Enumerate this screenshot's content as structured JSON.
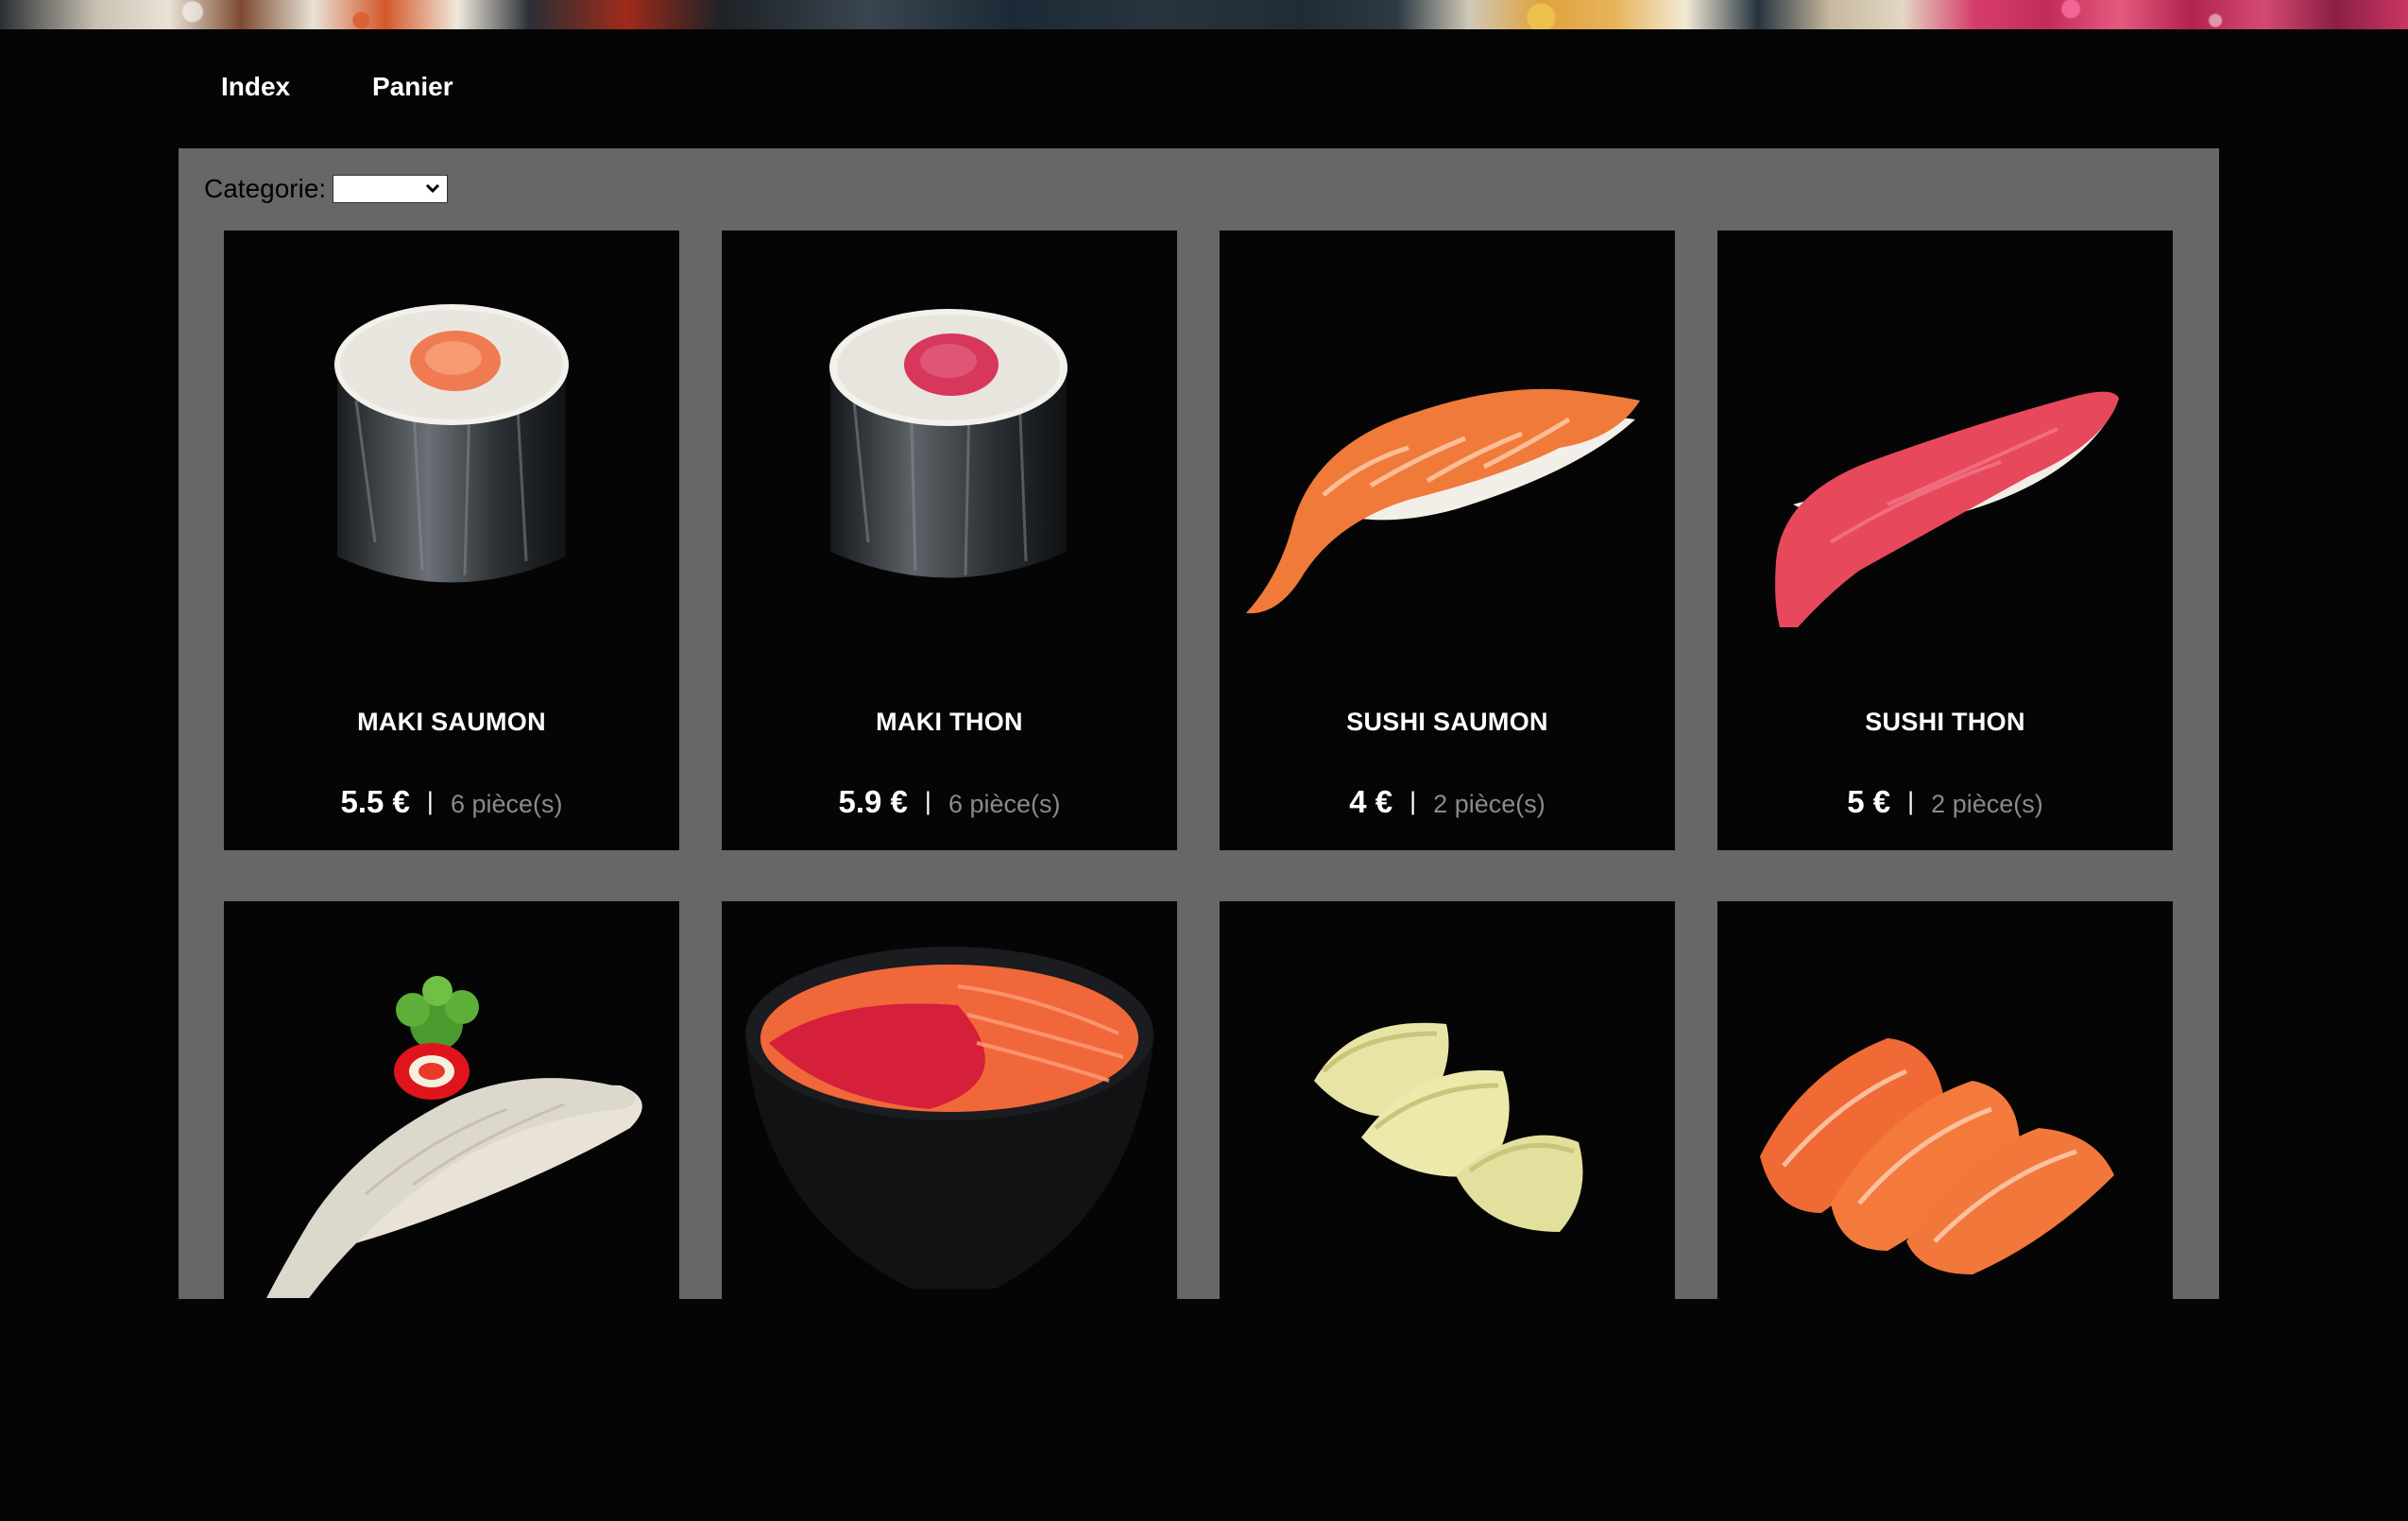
{
  "nav": {
    "items": [
      {
        "label": "Index"
      },
      {
        "label": "Panier"
      }
    ]
  },
  "filter": {
    "label": "Categorie:",
    "selected": "",
    "icon": "chevron-down-icon"
  },
  "colors": {
    "page_bg": "#050506",
    "panel_bg": "#676767",
    "card_bg": "#050506",
    "text": "#ffffff",
    "muted": "#8a8a8a"
  },
  "products": [
    {
      "name": "MAKI SAUMON",
      "price": "5.5 €",
      "separator": "|",
      "pieces": "6 pièce(s)",
      "image": "maki-saumon-image"
    },
    {
      "name": "MAKI THON",
      "price": "5.9 €",
      "separator": "|",
      "pieces": "6 pièce(s)",
      "image": "maki-thon-image"
    },
    {
      "name": "SUSHI SAUMON",
      "price": "4 €",
      "separator": "|",
      "pieces": "2 pièce(s)",
      "image": "sushi-saumon-image"
    },
    {
      "name": "SUSHI THON",
      "price": "5 €",
      "separator": "|",
      "pieces": "2 pièce(s)",
      "image": "sushi-thon-image"
    },
    {
      "image": "sushi-daurade-image"
    },
    {
      "image": "chirashi-bowl-image"
    },
    {
      "image": "gyoza-image"
    },
    {
      "image": "sashimi-saumon-image"
    }
  ]
}
